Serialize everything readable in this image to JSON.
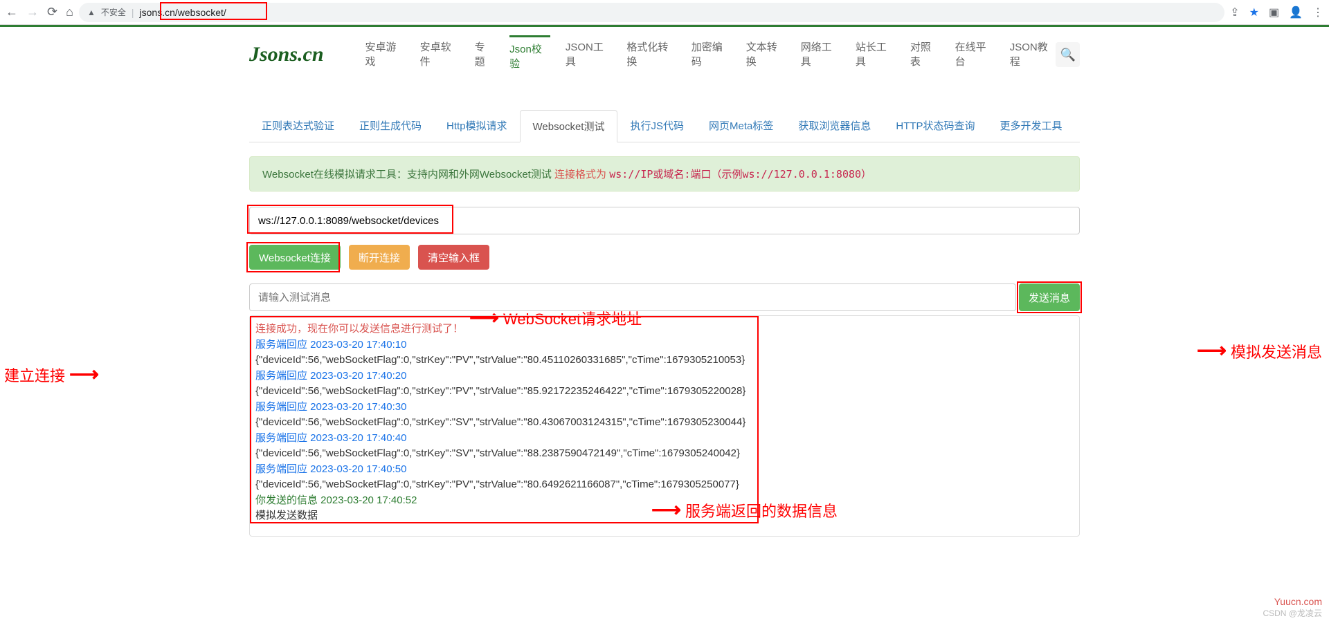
{
  "browser": {
    "url": "jsons.cn/websocket/",
    "not_secure": "不安全"
  },
  "logo": "Jsons.cn",
  "nav": {
    "items": [
      "安卓游戏",
      "安卓软件",
      "专题",
      "Json校验",
      "JSON工具",
      "格式化转换",
      "加密编码",
      "文本转换",
      "网络工具",
      "站长工具",
      "对照表",
      "在线平台",
      "JSON教程"
    ],
    "active_index": 3
  },
  "tabs": {
    "items": [
      "正则表达式验证",
      "正则生成代码",
      "Http模拟请求",
      "Websocket测试",
      "执行JS代码",
      "网页Meta标签",
      "获取浏览器信息",
      "HTTP状态码查询",
      "更多开发工具"
    ],
    "active_index": 3
  },
  "info": {
    "prefix": "Websocket在线模拟请求工具：支持内网和外网Websocket测试 ",
    "red_text": "连接格式为 ",
    "code": "ws://IP或域名:端口（示例ws://127.0.0.1:8080）"
  },
  "url_input": {
    "value": "ws://127.0.0.1:8089/websocket/devices"
  },
  "buttons": {
    "connect": "Websocket连接",
    "disconnect": "断开连接",
    "clear": "清空输入框",
    "send": "发送消息"
  },
  "msg_input": {
    "placeholder": "请输入测试消息"
  },
  "log": {
    "success": "连接成功，现在你可以发送信息进行测试了！",
    "resp_label": "服务端回应",
    "sent_label": "你发送的信息",
    "entries": [
      {
        "type": "resp",
        "time": "2023-03-20 17:40:10",
        "body": "{\"deviceId\":56,\"webSocketFlag\":0,\"strKey\":\"PV\",\"strValue\":\"80.45110260331685\",\"cTime\":1679305210053}"
      },
      {
        "type": "resp",
        "time": "2023-03-20 17:40:20",
        "body": "{\"deviceId\":56,\"webSocketFlag\":0,\"strKey\":\"PV\",\"strValue\":\"85.92172235246422\",\"cTime\":1679305220028}"
      },
      {
        "type": "resp",
        "time": "2023-03-20 17:40:30",
        "body": "{\"deviceId\":56,\"webSocketFlag\":0,\"strKey\":\"SV\",\"strValue\":\"80.43067003124315\",\"cTime\":1679305230044}"
      },
      {
        "type": "resp",
        "time": "2023-03-20 17:40:40",
        "body": "{\"deviceId\":56,\"webSocketFlag\":0,\"strKey\":\"SV\",\"strValue\":\"88.2387590472149\",\"cTime\":1679305240042}"
      },
      {
        "type": "resp",
        "time": "2023-03-20 17:40:50",
        "body": "{\"deviceId\":56,\"webSocketFlag\":0,\"strKey\":\"PV\",\"strValue\":\"80.6492621166087\",\"cTime\":1679305250077}"
      },
      {
        "type": "sent",
        "time": "2023-03-20 17:40:52",
        "body": "模拟发送数据"
      }
    ]
  },
  "annotations": {
    "ws_url": "WebSocket请求地址",
    "establish": "建立连接",
    "simulate_send": "模拟发送消息",
    "server_data": "服务端返回的数据信息"
  },
  "watermark": {
    "line1": "Yuucn.com",
    "line2": "CSDN @龙凌云"
  }
}
